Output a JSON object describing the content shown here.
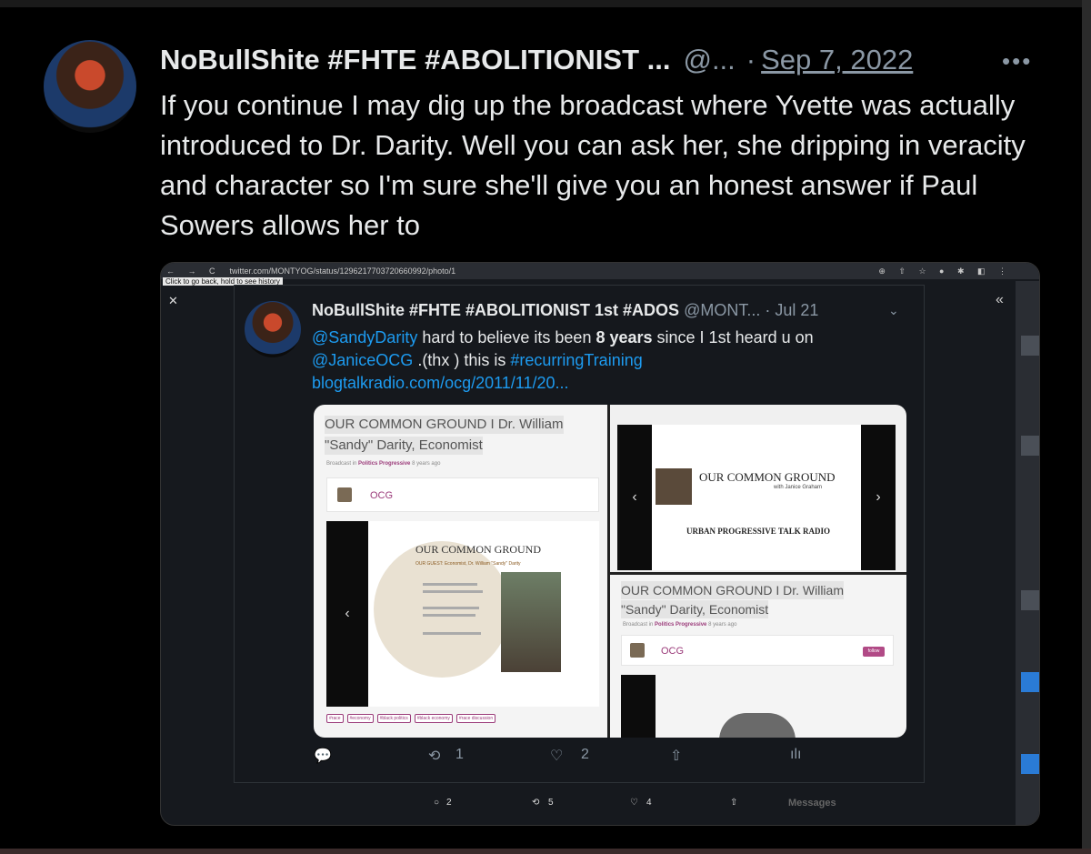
{
  "tweet": {
    "display_name": "NoBullShite #FHTE #ABOLITIONIST ...",
    "handle": "@...",
    "separator": "·",
    "date": "Sep 7, 2022",
    "more_glyph": "•••",
    "text": "If you continue I may  dig up the broadcast where Yvette was actually introduced to Dr. Darity. Well you can ask her, she dripping in veracity and character so I'm sure she'll give you an honest answer if Paul Sowers allows her to"
  },
  "screenshot": {
    "browser": {
      "nav": "← → C",
      "url": "twitter.com/MONTYOG/status/1296217703720660992/photo/1",
      "tooltip": "Click to go back, hold to see history",
      "tools": "⊕ ⇧ ☆ ● ✱ ◧ ⋮"
    },
    "close": "✕",
    "collapse": "«",
    "inner_tweet": {
      "display_name": "NoBullShite #FHTE #ABOLITIONIST 1st #ADOS",
      "handle": "@MONT...",
      "date": "· Jul 21",
      "chevron": "⌄",
      "mention1": "@SandyDarity",
      "text1": "  hard to believe its been ",
      "bold1": "8 years",
      "text2": " since I 1st heard u on",
      "mention2": "@JaniceOCG",
      "text3": " .(thx ) this is ",
      "hashtag": "#recurringTraining",
      "link": "blogtalkradio.com/ocg/2011/11/20..."
    },
    "media": {
      "episode_title_1": "OUR COMMON GROUND I Dr. William",
      "episode_title_2": "\"Sandy\" Darity, Economist",
      "broadcast_in": "Broadcast in",
      "category": "Politics Progressive",
      "ago": "8 years ago",
      "host": "OCG",
      "follow": "follow",
      "poster_title": "OUR COMMON GROUND",
      "poster_guest": "OUR GUEST: Economist, Dr. William \"Sandy\" Darity",
      "poster2_title": "OUR COMMON GROUND",
      "poster2_sub": "with Janice Graham",
      "poster2_footer": "URBAN  PROGRESSIVE  TALK  RADIO",
      "tags": [
        "#race",
        "#economy",
        "#black politics",
        "#black economy",
        "#race discussion"
      ],
      "prev": "‹",
      "next": "›"
    },
    "inner_actions": {
      "reply_icon": "💬",
      "retweet_icon": "⟲",
      "retweets": "1",
      "like_icon": "♡",
      "likes": "2",
      "share_icon": "⇧",
      "stats_icon": "ılı"
    },
    "under_actions": {
      "replies": "2",
      "retweets": "5",
      "likes": "4"
    },
    "messages_label": "Messages"
  }
}
